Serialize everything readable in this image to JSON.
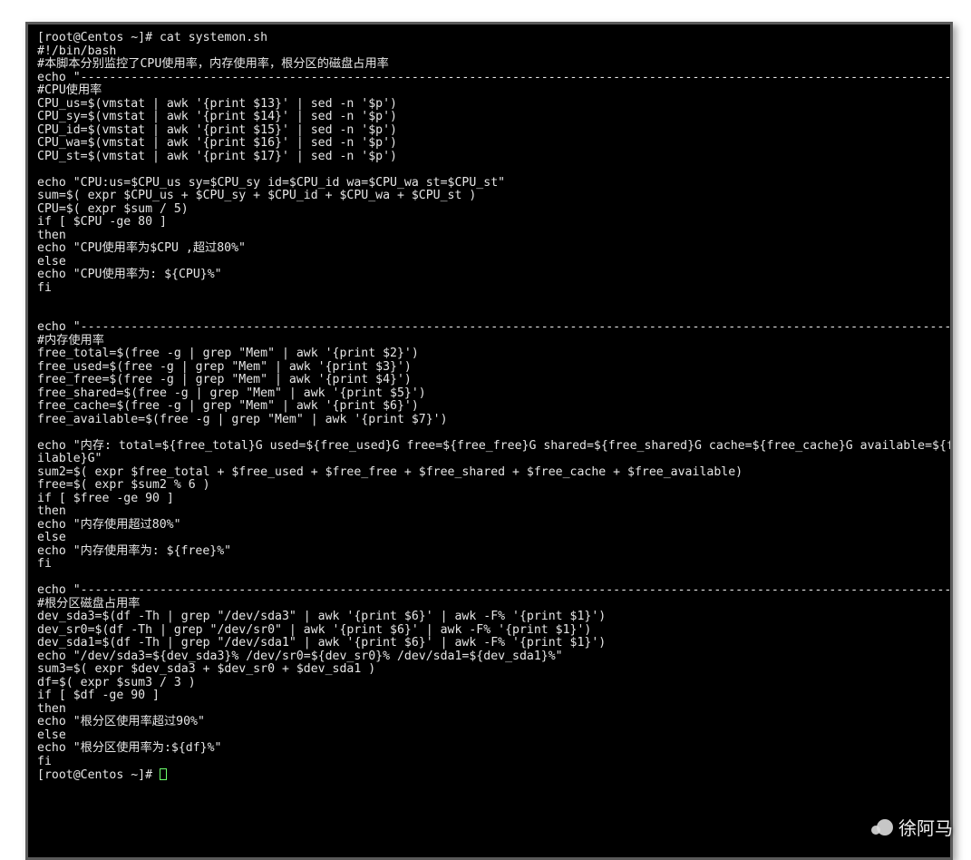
{
  "watermark": {
    "label": "徐阿马"
  },
  "terminal": {
    "prompt_before": "[root@Centos ~]# cat systemon.sh",
    "prompt_after": "[root@Centos ~]# ",
    "content": "[root@Centos ~]# cat systemon.sh\n#!/bin/bash\n#本脚本分别监控了CPU使用率，内存使用率，根分区的磁盘占用率\necho \"--------------------------------------------------------------------------------------------------------------------------------------\n#CPU使用率\nCPU_us=$(vmstat | awk '{print $13}' | sed -n '$p')\nCPU_sy=$(vmstat | awk '{print $14}' | sed -n '$p')\nCPU_id=$(vmstat | awk '{print $15}' | sed -n '$p')\nCPU_wa=$(vmstat | awk '{print $16}' | sed -n '$p')\nCPU_st=$(vmstat | awk '{print $17}' | sed -n '$p')\n\necho \"CPU:us=$CPU_us sy=$CPU_sy id=$CPU_id wa=$CPU_wa st=$CPU_st\"\nsum=$( expr $CPU_us + $CPU_sy + $CPU_id + $CPU_wa + $CPU_st )\nCPU=$( expr $sum / 5)\nif [ $CPU -ge 80 ]\nthen\necho \"CPU使用率为$CPU ,超过80%\"\nelse\necho \"CPU使用率为: ${CPU}%\"\nfi\n\n\necho \"--------------------------------------------------------------------------------------------------------------------------------------\n#内存使用率\nfree_total=$(free -g | grep \"Mem\" | awk '{print $2}')\nfree_used=$(free -g | grep \"Mem\" | awk '{print $3}')\nfree_free=$(free -g | grep \"Mem\" | awk '{print $4}')\nfree_shared=$(free -g | grep \"Mem\" | awk '{print $5}')\nfree_cache=$(free -g | grep \"Mem\" | awk '{print $6}')\nfree_available=$(free -g | grep \"Mem\" | awk '{print $7}')\n\necho \"内存: total=${free_total}G used=${free_used}G free=${free_free}G shared=${free_shared}G cache=${free_cache}G available=${f\nilable}G\"\nsum2=$( expr $free_total + $free_used + $free_free + $free_shared + $free_cache + $free_available)\nfree=$( expr $sum2 % 6 )\nif [ $free -ge 90 ]\nthen\necho \"内存使用超过80%\"\nelse\necho \"内存使用率为: ${free}%\"\nfi\n\necho \"--------------------------------------------------------------------------------------------------------------------------------------\n#根分区磁盘占用率\ndev_sda3=$(df -Th | grep \"/dev/sda3\" | awk '{print $6}' | awk -F% '{print $1}')\ndev_sr0=$(df -Th | grep \"/dev/sr0\" | awk '{print $6}' | awk -F% '{print $1}')\ndev_sda1=$(df -Th | grep \"/dev/sda1\" | awk '{print $6}' | awk -F% '{print $1}')\necho \"/dev/sda3=${dev_sda3}% /dev/sr0=${dev_sr0}% /dev/sda1=${dev_sda1}%\"\nsum3=$( expr $dev_sda3 + $dev_sr0 + $dev_sda1 )\ndf=$( expr $sum3 / 3 )\nif [ $df -ge 90 ]\nthen\necho \"根分区使用率超过90%\"\nelse\necho \"根分区使用率为:${df}%\"\nfi\n[root@Centos ~]# "
  }
}
